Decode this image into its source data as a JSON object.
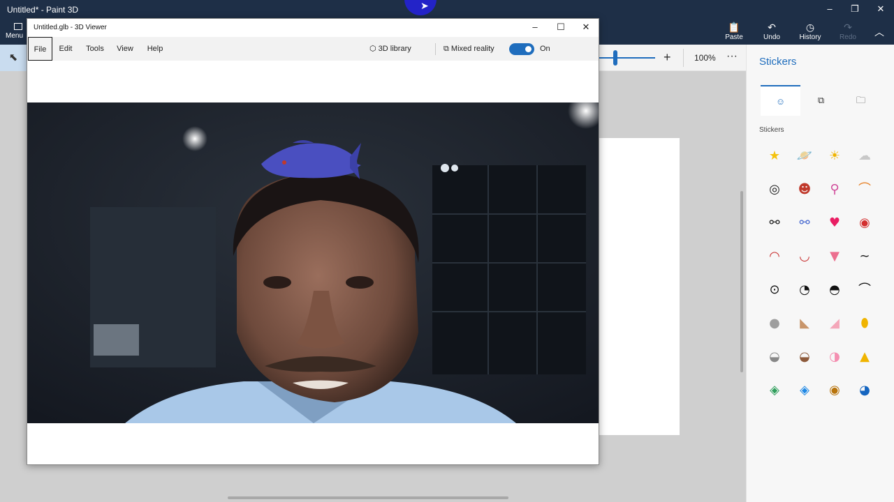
{
  "app": {
    "title": "Untitled* - Paint 3D",
    "menu_label": "Menu"
  },
  "ribbon": {
    "paste": "Paste",
    "undo": "Undo",
    "history": "History",
    "redo": "Redo"
  },
  "toolbar": {
    "zoom_percent": "100%",
    "zoom_level": 0.3
  },
  "viewer": {
    "title": "Untitled.glb - 3D Viewer",
    "menu": [
      "File",
      "Edit",
      "Tools",
      "View",
      "Help"
    ],
    "library": "3D library",
    "mixed_reality": "Mixed reality",
    "toggle_state": "On"
  },
  "panel": {
    "title": "Stickers",
    "section": "Stickers",
    "stickers": [
      "star-face",
      "planet",
      "sun-face",
      "cloud",
      "spiral",
      "robot-face",
      "lollipop",
      "rainbow",
      "eyeglasses",
      "sunglasses",
      "heart",
      "red-lips",
      "open-mouth",
      "smile-mouth",
      "tongue-out",
      "mustache",
      "eye-round",
      "eye-up",
      "eye-down",
      "eyebrow",
      "ear-grey",
      "ear-tan",
      "ear-pink",
      "ear-yellow",
      "snout-grey",
      "snout-brown",
      "snout-pink",
      "beak-yellow",
      "cat-eye-green",
      "cat-eye-blue",
      "eye-brown",
      "eye-lashes"
    ]
  },
  "colors": {
    "accent": "#1f6dbd",
    "titlebar": "#1e2f47",
    "fish": "#4a4fc0"
  }
}
